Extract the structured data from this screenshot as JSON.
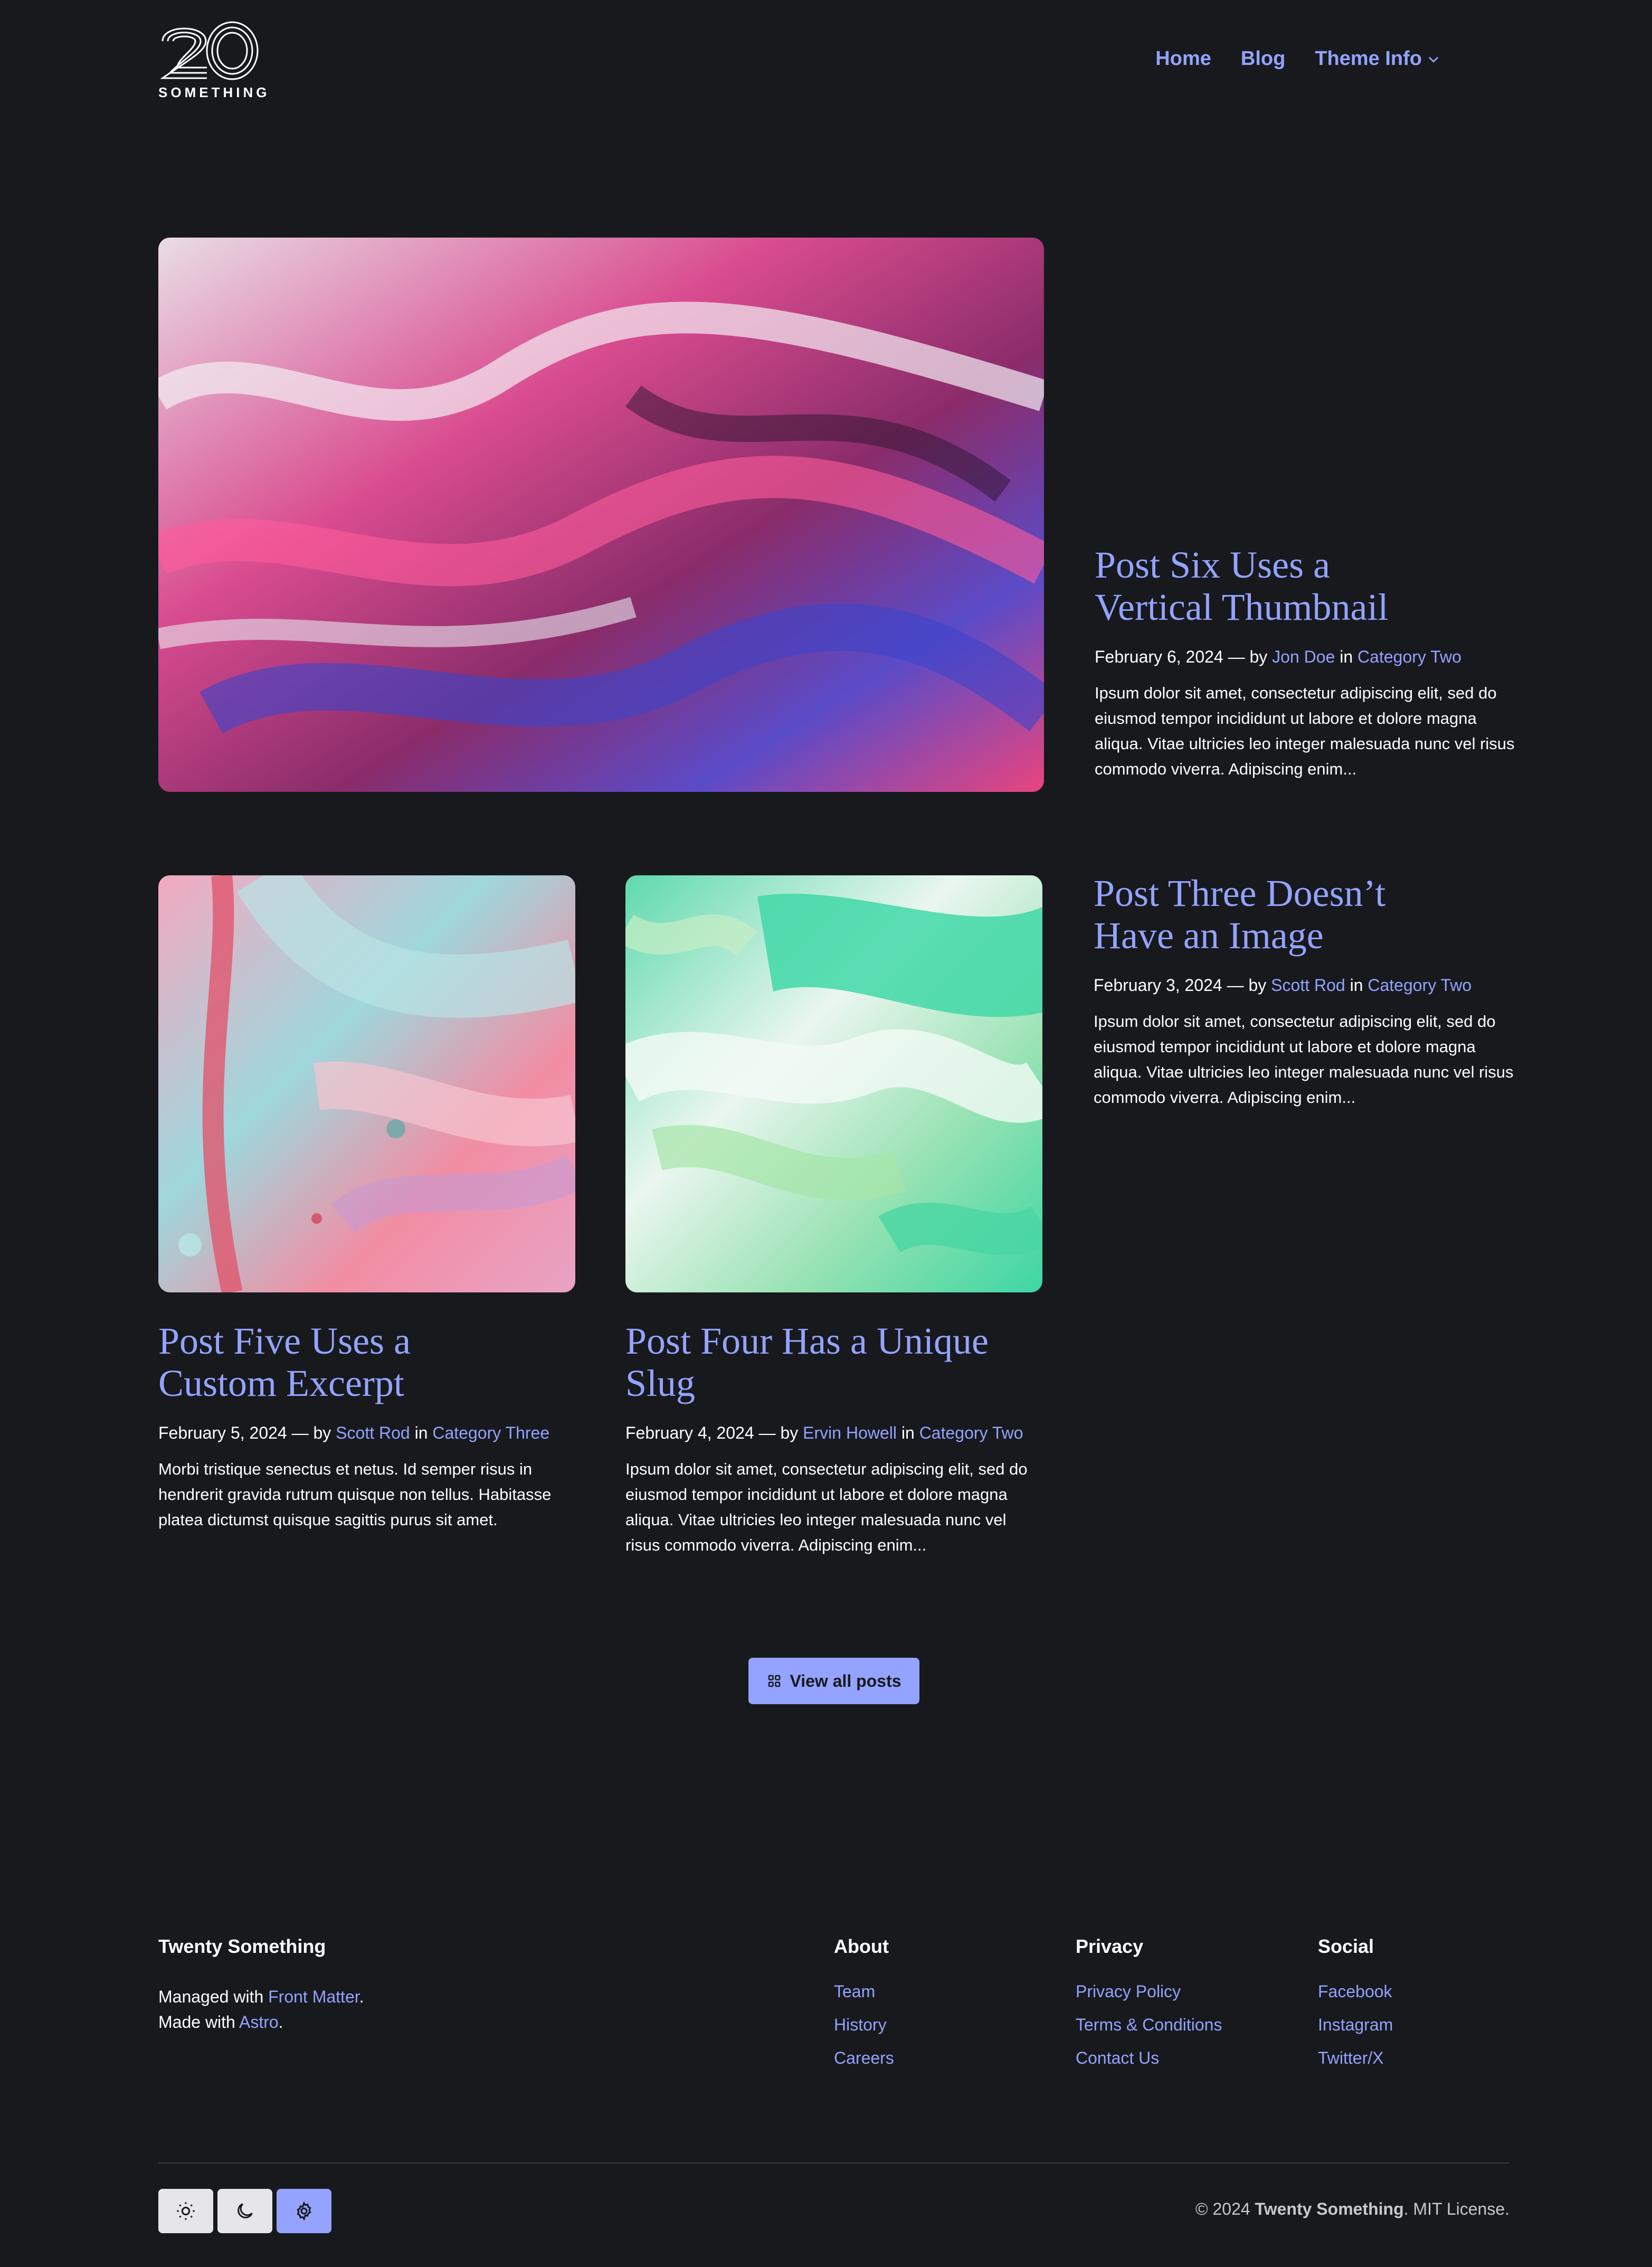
{
  "header": {
    "logo_number": "20",
    "logo_text": "SOMETHING",
    "nav": [
      {
        "label": "Home"
      },
      {
        "label": "Blog"
      },
      {
        "label": "Theme Info"
      }
    ]
  },
  "posts": [
    {
      "title_line1": "Post Six Uses a",
      "title_line2": "Vertical Thumbnail",
      "date": "February 6, 2024 — by",
      "author": "Jon Doe",
      "in": "in",
      "category": "Category Two",
      "excerpt": "Ipsum dolor sit amet, consectetur adipiscing elit, sed do eiusmod tempor incididunt ut labore et dolore magna aliqua. Vitae ultricies leo integer malesuada nunc vel risus commodo viverra. Adipiscing enim..."
    },
    {
      "title_line1": "Post Three Doesn’t",
      "title_line2": "Have an Image",
      "date": "February 3, 2024 — by",
      "author": "Scott Rod",
      "in": "in",
      "category": "Category Two",
      "excerpt": "Ipsum dolor sit amet, consectetur adipiscing elit, sed do eiusmod tempor incididunt ut labore et dolore magna aliqua. Vitae ultricies leo integer malesuada nunc vel risus commodo viverra. Adipiscing enim..."
    },
    {
      "title_line1": "Post Five Uses a",
      "title_line2": "Custom Excerpt",
      "date": "February 5, 2024 — by",
      "author": "Scott Rod",
      "in": "in",
      "category": "Category Three",
      "excerpt": "Morbi tristique senectus et netus. Id semper risus in hendrerit gravida rutrum quisque non tellus. Habitasse platea dictumst quisque sagittis purus sit amet."
    },
    {
      "title_line1": "Post Four Has a Unique Slug",
      "date": "February 4, 2024 — by",
      "author": "Ervin Howell",
      "in": "in",
      "category": "Category Two",
      "excerpt": "Ipsum dolor sit amet, consectetur adipiscing elit, sed do eiusmod tempor incididunt ut labore et dolore magna aliqua. Vitae ultricies leo integer malesuada nunc vel risus commodo viverra. Adipiscing enim..."
    }
  ],
  "view_all_label": "View all posts",
  "footer": {
    "brand": "Twenty Something",
    "managed_prefix": "Managed with",
    "managed_link": "Front Matter",
    "made_prefix": "Made with",
    "made_link": "Astro",
    "period": ".",
    "columns": [
      {
        "title": "About",
        "links": [
          "Team",
          "History",
          "Careers"
        ]
      },
      {
        "title": "Privacy",
        "links": [
          "Privacy Policy",
          "Terms & Conditions",
          "Contact Us"
        ]
      },
      {
        "title": "Social",
        "links": [
          "Facebook",
          "Instagram",
          "Twitter/X"
        ]
      }
    ],
    "copyright_prefix": "© 2024",
    "copyright_brand": "Twenty Something",
    "copyright_suffix": ". MIT License."
  },
  "colors": {
    "background": "#18191d",
    "accent": "#93a3ff"
  }
}
